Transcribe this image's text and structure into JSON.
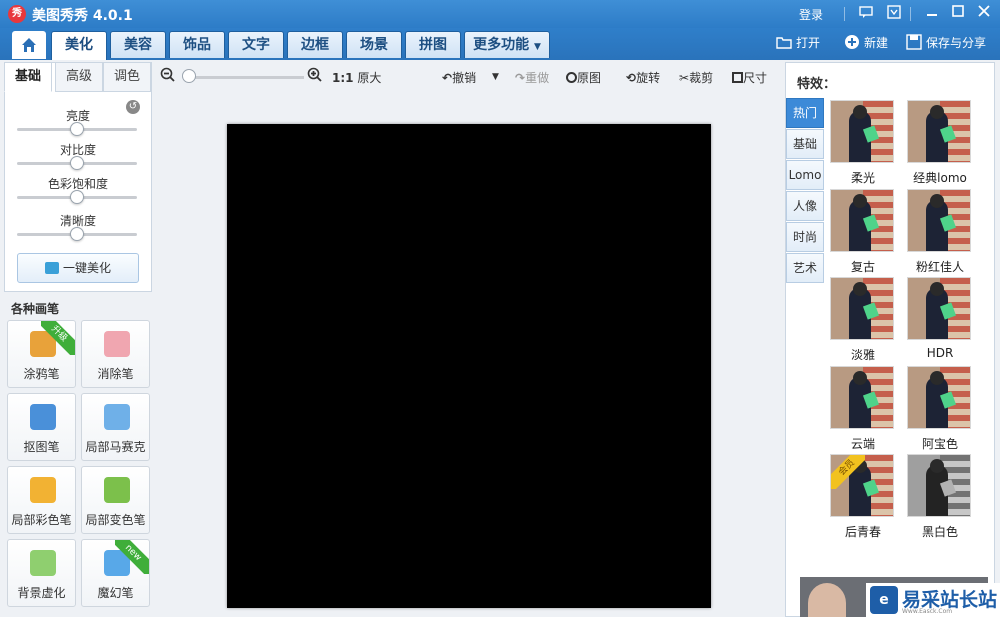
{
  "app": {
    "logo_char": "秀",
    "title": "美图秀秀 4.0.1",
    "login": "登录"
  },
  "nav": {
    "tabs": [
      "美化",
      "美容",
      "饰品",
      "文字",
      "边框",
      "场景",
      "拼图",
      "更多功能"
    ],
    "active_tab": "美化",
    "open": "打开",
    "new": "新建",
    "save_share": "保存与分享"
  },
  "adjust": {
    "tabs": [
      "基础",
      "高级",
      "调色"
    ],
    "sliders": [
      {
        "label": "亮度",
        "value": 0.5
      },
      {
        "label": "对比度",
        "value": 0.5
      },
      {
        "label": "色彩饱和度",
        "value": 0.5
      },
      {
        "label": "清晰度",
        "value": 0.5
      }
    ],
    "one_click": "一键美化"
  },
  "brushes": {
    "title": "各种画笔",
    "items": [
      {
        "label": "涂鸦笔",
        "badge": "升级",
        "color": "#e8a23a"
      },
      {
        "label": "消除笔",
        "badge": "",
        "color": "#f0a6b0"
      },
      {
        "label": "抠图笔",
        "badge": "",
        "color": "#4a90d9"
      },
      {
        "label": "局部马赛克",
        "badge": "",
        "color": "#6fb0e8"
      },
      {
        "label": "局部彩色笔",
        "badge": "",
        "color": "#f2b233"
      },
      {
        "label": "局部变色笔",
        "badge": "",
        "color": "#7cc04b"
      },
      {
        "label": "背景虚化",
        "badge": "",
        "color": "#8fcf6f"
      },
      {
        "label": "魔幻笔",
        "badge": "new",
        "color": "#58a8e8"
      }
    ]
  },
  "toolbar": {
    "ratio": "1:1",
    "original_size": "原大",
    "undo": "撤销",
    "redo": "重做",
    "original": "原图",
    "rotate": "旋转",
    "crop": "裁剪",
    "resize": "尺寸"
  },
  "effects": {
    "title": "特效：",
    "categories": [
      "热门",
      "基础",
      "Lomo",
      "人像",
      "时尚",
      "艺术"
    ],
    "active_category": "热门",
    "items": [
      {
        "name": "柔光"
      },
      {
        "name": "经典lomo"
      },
      {
        "name": "复古"
      },
      {
        "name": "粉红佳人"
      },
      {
        "name": "淡雅"
      },
      {
        "name": "HDR"
      },
      {
        "name": "云端"
      },
      {
        "name": "阿宝色"
      },
      {
        "name": "后青春",
        "badge": "会员"
      },
      {
        "name": "黑白色"
      }
    ]
  },
  "watermark": {
    "text": "易采站长站",
    "sub": "Www.Easck.Com"
  },
  "colors": {
    "title_bar": "#2d7cc7",
    "accent": "#3c8ad8",
    "photo": "#000000"
  }
}
